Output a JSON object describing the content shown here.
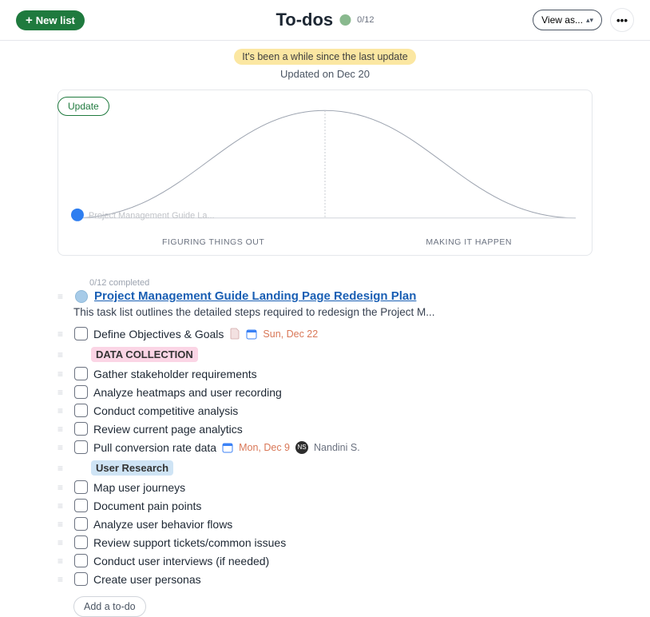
{
  "header": {
    "new_list": "New list",
    "title": "To-dos",
    "count": "0/12",
    "view_as": "View as...",
    "more": "•••"
  },
  "banner": {
    "update": "Update",
    "stale": "It's been a while since the last update",
    "updated_on": "Updated on Dec 20"
  },
  "hill": {
    "left_label": "FIGURING THINGS OUT",
    "right_label": "MAKING IT HAPPEN",
    "marker_label": "Project Management Guide La..."
  },
  "list": {
    "completed": "0/12 completed",
    "title": "Project Management Guide Landing Page Redesign Plan",
    "desc": "This task list outlines the detailed steps required to redesign the Project M...",
    "sections": [
      {
        "label": "DATA COLLECTION",
        "style": "pink"
      },
      {
        "label": "User Research",
        "style": "blue"
      }
    ],
    "tasks_top": [
      {
        "label": "Define Objectives & Goals",
        "doc": true,
        "date": "Sun, Dec 22"
      }
    ],
    "tasks_section1": [
      {
        "label": "Gather stakeholder requirements"
      },
      {
        "label": "Analyze heatmaps and user recording"
      },
      {
        "label": "Conduct competitive analysis"
      },
      {
        "label": "Review current page analytics"
      },
      {
        "label": "Pull conversion rate data",
        "date": "Mon, Dec 9",
        "assignee": "Nandini S."
      }
    ],
    "tasks_section2": [
      {
        "label": "Map user journeys"
      },
      {
        "label": "Document pain points"
      },
      {
        "label": "Analyze user behavior flows"
      },
      {
        "label": "Review support tickets/common issues"
      },
      {
        "label": "Conduct user interviews (if needed)"
      },
      {
        "label": "Create user personas"
      }
    ],
    "add": "Add a to-do"
  }
}
